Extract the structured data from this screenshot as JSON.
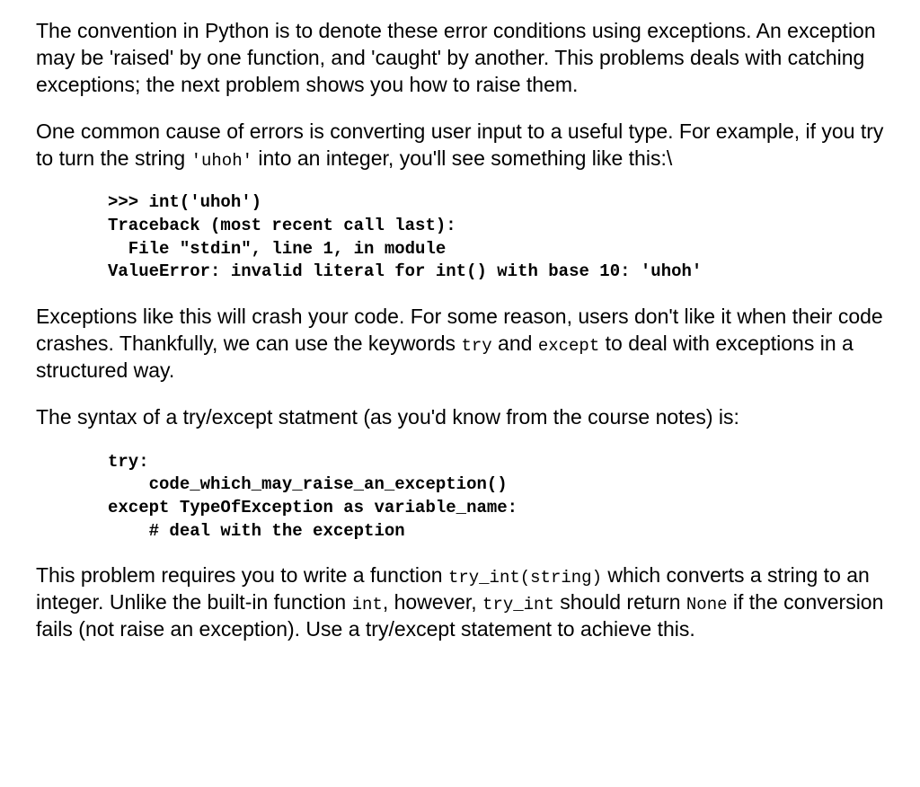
{
  "para1": {
    "text": "The convention in Python is to denote these error conditions using exceptions. An exception may be 'raised' by one function, and 'caught' by another. This problems deals with catching exceptions; the next problem shows you how to raise them."
  },
  "para2": {
    "part1": "One common cause of errors is converting user input to a useful type. For example, if you try to turn the string ",
    "code1": "'uhoh'",
    "part2": " into an integer, you'll see something like this:\\"
  },
  "codeblock1": ">>> int('uhoh')\nTraceback (most recent call last):\n  File \"stdin\", line 1, in module\nValueError: invalid literal for int() with base 10: 'uhoh'",
  "para3": {
    "part1": "Exceptions like this will crash your code. For some reason, users don't like it when their code crashes. Thankfully, we can use the keywords ",
    "code1": "try",
    "part2": " and ",
    "code2": "except",
    "part3": " to deal with exceptions in a structured way."
  },
  "para4": {
    "text": "The syntax of a try/except statment (as you'd know from the course notes) is:"
  },
  "codeblock2": "try:\n    code_which_may_raise_an_exception()\nexcept TypeOfException as variable_name:\n    # deal with the exception",
  "para5": {
    "part1": "This problem requires you to write a function ",
    "code1": "try_int(string)",
    "part2": " which converts a string to an integer. Unlike the built-in function ",
    "code2": "int",
    "part3": ", however, ",
    "code3": "try_int",
    "part4": " should return ",
    "code4": "None",
    "part5": " if the conversion fails (not raise an exception). Use a try/except statement to achieve this."
  }
}
